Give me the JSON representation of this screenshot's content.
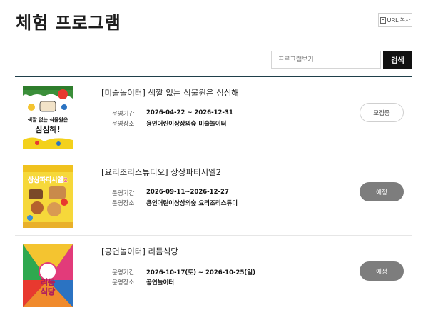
{
  "page": {
    "title": "체험 프로그램"
  },
  "url_copy": {
    "label": "URL 복사",
    "icon": "copy-icon"
  },
  "search": {
    "placeholder": "프로그램보기",
    "value": "",
    "button_label": "검색"
  },
  "labels": {
    "period": "운영기간",
    "place": "운영장소"
  },
  "colors": {
    "accent_line": "#1f3f4a",
    "search_button": "#111111",
    "status_soon": "#7d7d7d"
  },
  "programs": [
    {
      "title": "[미술놀이터] 색깔 없는 식물원은 심심해",
      "period": "2026-04-22 ~ 2026-12-31",
      "place": "용인어린이상상의숲 미술놀이터",
      "status": "모집중",
      "poster_text": "색깔 없는 식물원은 심심해!"
    },
    {
      "title": "[요리조리스튜디오] 상상파티시엘2",
      "period": "2026-09-11~2026-12-27",
      "place": "용인어린이상상의숲 요리조리스튜디",
      "status": "예정",
      "poster_text": "상상파티시엘2"
    },
    {
      "title": "[공연놀이터] 리듬식당",
      "period": "2026-10-17(토) ~ 2026-10-25(일)",
      "place": "공연놀이터",
      "status": "예정",
      "poster_text": "리듬식당"
    }
  ]
}
